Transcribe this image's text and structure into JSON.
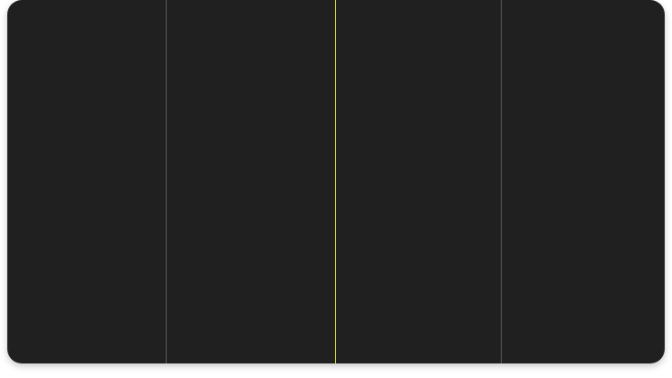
{
  "colors": {
    "panel_background": "#202020",
    "divider": "#5a5a5a",
    "accent_line": "#d7e12a"
  }
}
